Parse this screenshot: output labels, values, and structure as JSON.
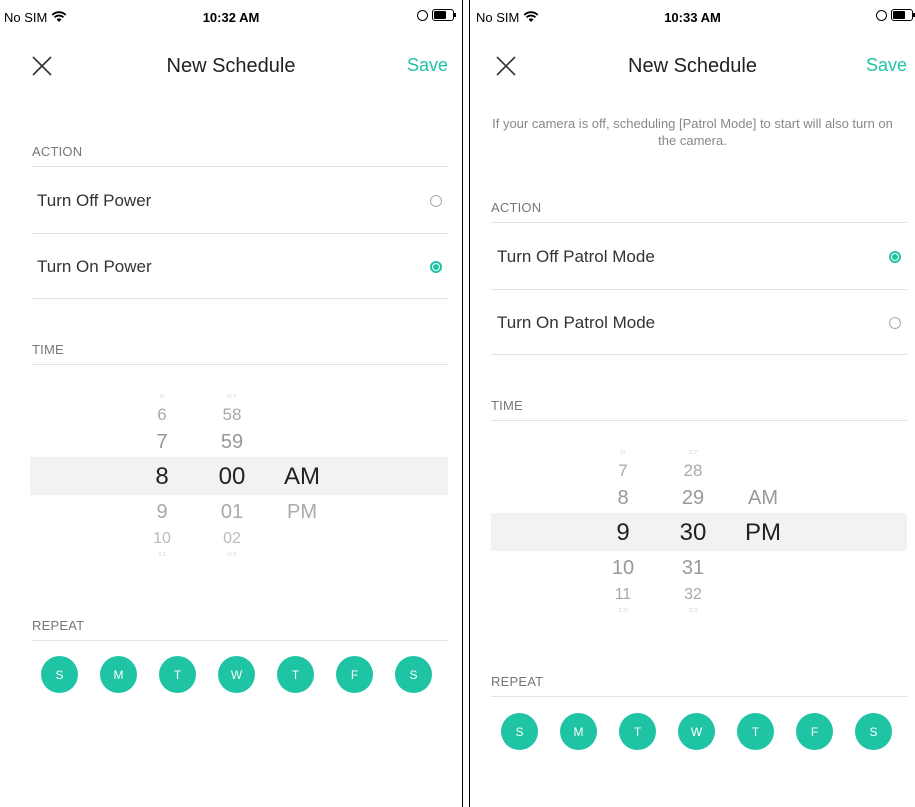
{
  "screens": [
    {
      "status": {
        "carrier": "No SIM",
        "time": "10:32 AM"
      },
      "nav": {
        "title": "New Schedule",
        "save": "Save"
      },
      "action_label": "ACTION",
      "options": [
        {
          "label": "Turn Off Power",
          "selected": false
        },
        {
          "label": "Turn On Power",
          "selected": true
        }
      ],
      "time_label": "TIME",
      "picker": {
        "hours": [
          "5",
          "6",
          "7",
          "8",
          "9",
          "10",
          "11"
        ],
        "minutes": [
          "57",
          "58",
          "59",
          "00",
          "01",
          "02",
          "03"
        ],
        "ampm": [
          "AM",
          "PM"
        ],
        "selected": {
          "hour": "8",
          "minute": "00",
          "period": "AM"
        }
      },
      "repeat_label": "REPEAT",
      "days": [
        "S",
        "M",
        "T",
        "W",
        "T",
        "F",
        "S"
      ]
    },
    {
      "status": {
        "carrier": "No SIM",
        "time": "10:33 AM"
      },
      "nav": {
        "title": "New Schedule",
        "save": "Save"
      },
      "notice": "If your camera is off, scheduling [Patrol Mode] to start will also turn on the camera.",
      "action_label": "ACTION",
      "options": [
        {
          "label": "Turn Off Patrol Mode",
          "selected": true
        },
        {
          "label": "Turn On Patrol Mode",
          "selected": false
        }
      ],
      "time_label": "TIME",
      "picker": {
        "hours": [
          "6",
          "7",
          "8",
          "9",
          "10",
          "11",
          "12"
        ],
        "minutes": [
          "27",
          "28",
          "29",
          "30",
          "31",
          "32",
          "33"
        ],
        "ampm": [
          "AM",
          "PM"
        ],
        "selected": {
          "hour": "9",
          "minute": "30",
          "period": "PM"
        }
      },
      "repeat_label": "REPEAT",
      "days": [
        "S",
        "M",
        "T",
        "W",
        "T",
        "F",
        "S"
      ]
    }
  ],
  "colors": {
    "accent": "#1fc4a5",
    "selection_band": "#f2f2f2"
  },
  "icons": {
    "close": "close-icon",
    "wifi": "wifi-icon",
    "battery": "battery-icon",
    "radio": "radio-button"
  }
}
